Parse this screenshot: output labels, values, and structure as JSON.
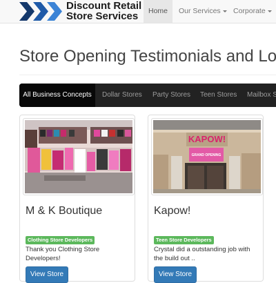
{
  "brand": {
    "line1": "Discount Retail",
    "line2": "Store Services"
  },
  "nav": {
    "items": [
      {
        "label": "Home",
        "active": true
      },
      {
        "label": "Our Services",
        "dropdown": true
      },
      {
        "label": "Corporate",
        "dropdown": true
      }
    ]
  },
  "page": {
    "title": "Store Opening Testimonials and Loc"
  },
  "filters": {
    "items": [
      {
        "label": "All Business Concepts",
        "active": true
      },
      {
        "label": "Dollar Stores"
      },
      {
        "label": "Party Stores"
      },
      {
        "label": "Teen Stores"
      },
      {
        "label": "Mailbox S"
      }
    ]
  },
  "cards": [
    {
      "title": "M & K Boutique",
      "badge": "Clothing Store Developers",
      "description": "Thank you Clothing Store Developers!",
      "button": "View Store"
    },
    {
      "title": "Kapow!",
      "badge": "Teen Store Developers",
      "description": "Crystal did a outstanding job with the build out ..",
      "button": "View Store",
      "sign_text": "KAPOW!",
      "banner_text": "GRAND OPENING"
    }
  ],
  "colors": {
    "primary": "#337ab7",
    "badge": "#5cb85c",
    "filterbar": "#222222",
    "logo_blue": "#1f5aa8"
  }
}
